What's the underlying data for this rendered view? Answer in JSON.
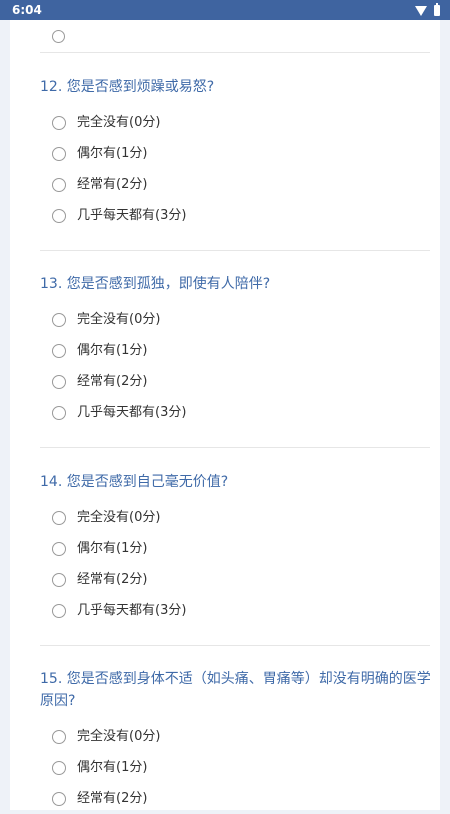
{
  "status_bar": {
    "time": "6:04",
    "icons": [
      "wifi-icon",
      "battery-icon"
    ]
  },
  "colors": {
    "status_bar": "#3f64a0",
    "question_title": "#3f6aa8",
    "page_background": "#eef2f8",
    "card_background": "#ffffff"
  },
  "questions": [
    {
      "number": "12",
      "title": "12. 您是否感到烦躁或易怒?",
      "options": [
        "完全没有(0分)",
        "偶尔有(1分)",
        "经常有(2分)",
        "几乎每天都有(3分)"
      ]
    },
    {
      "number": "13",
      "title": "13. 您是否感到孤独，即使有人陪伴?",
      "options": [
        "完全没有(0分)",
        "偶尔有(1分)",
        "经常有(2分)",
        "几乎每天都有(3分)"
      ]
    },
    {
      "number": "14",
      "title": "14. 您是否感到自己毫无价值?",
      "options": [
        "完全没有(0分)",
        "偶尔有(1分)",
        "经常有(2分)",
        "几乎每天都有(3分)"
      ]
    },
    {
      "number": "15",
      "title": "15. 您是否感到身体不适（如头痛、胃痛等）却没有明确的医学原因?",
      "options": [
        "完全没有(0分)",
        "偶尔有(1分)",
        "经常有(2分)"
      ]
    }
  ]
}
